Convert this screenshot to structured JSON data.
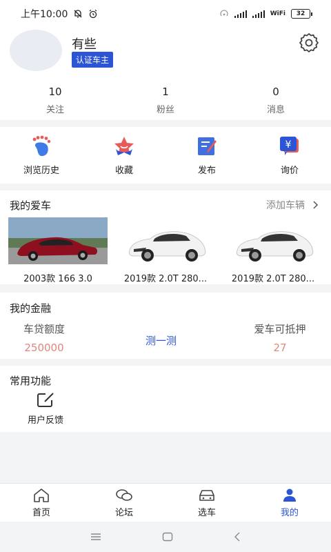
{
  "status_bar": {
    "time": "上午10:00",
    "battery": "32",
    "network": "WiFi"
  },
  "profile": {
    "username": "有些",
    "badge": "认证车主",
    "stats": [
      {
        "value": "10",
        "label": "关注"
      },
      {
        "value": "1",
        "label": "粉丝"
      },
      {
        "value": "0",
        "label": "消息"
      }
    ]
  },
  "quick_actions": [
    {
      "label": "浏览历史",
      "icon": "footprint-icon"
    },
    {
      "label": "收藏",
      "icon": "star-icon"
    },
    {
      "label": "发布",
      "icon": "edit-icon"
    },
    {
      "label": "询价",
      "icon": "price-inquiry-icon"
    }
  ],
  "my_cars": {
    "title": "我的爱车",
    "add_label": "添加车辆",
    "cars": [
      {
        "name": "2003款 166 3.0"
      },
      {
        "name": "2019款 2.0T 280..."
      },
      {
        "name": "2019款 2.0T 280..."
      }
    ]
  },
  "finance": {
    "title": "我的金融",
    "loan_label": "车贷额度",
    "loan_value": "250000",
    "measure_label": "测一测",
    "mortgage_label": "爱车可抵押",
    "mortgage_value": "27"
  },
  "common": {
    "title": "常用功能",
    "feedback_label": "用户反馈"
  },
  "tabs": [
    {
      "label": "首页",
      "icon": "home-icon"
    },
    {
      "label": "论坛",
      "icon": "forum-icon"
    },
    {
      "label": "选车",
      "icon": "car-icon"
    },
    {
      "label": "我的",
      "icon": "person-icon"
    }
  ],
  "colors": {
    "accent": "#2c55d6",
    "highlight_value": "#e0867d",
    "background": "#f3f4f6"
  }
}
